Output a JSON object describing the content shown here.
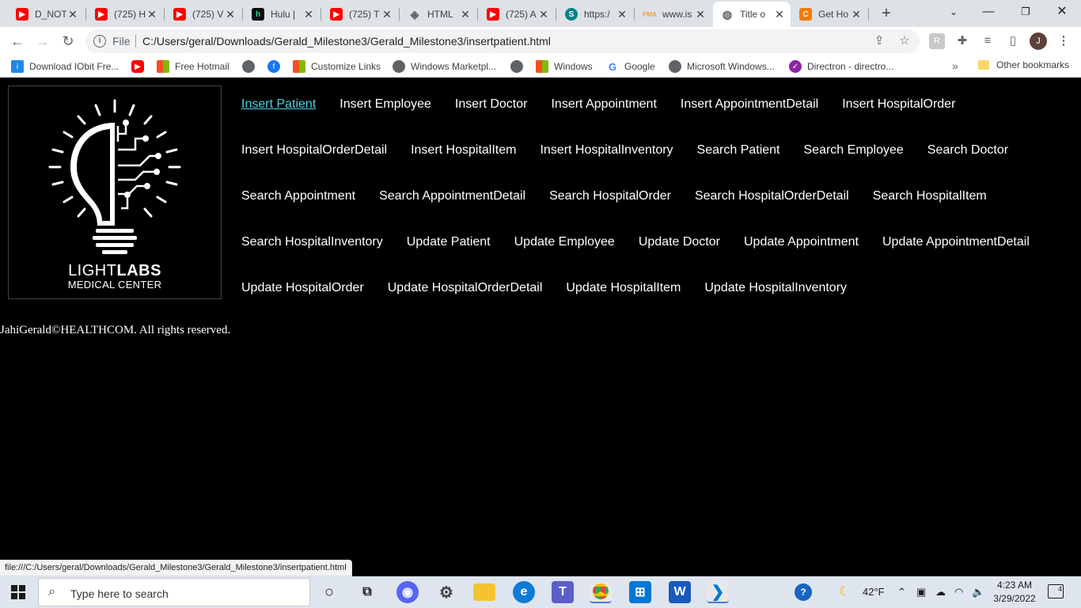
{
  "browser": {
    "tabs": [
      {
        "title": "D_NOT",
        "favicon": "youtube-icon",
        "color": "#ff0000"
      },
      {
        "title": "(725) H",
        "favicon": "youtube-icon",
        "color": "#ff0000"
      },
      {
        "title": "(725) V",
        "favicon": "youtube-icon",
        "color": "#ff0000"
      },
      {
        "title": "Hulu |",
        "favicon": "hulu-icon",
        "color": "#1ce783"
      },
      {
        "title": "(725) T",
        "favicon": "youtube-icon",
        "color": "#ff0000"
      },
      {
        "title": "HTML",
        "favicon": "diamond-icon",
        "color": "#5f6368"
      },
      {
        "title": "(725) A",
        "favicon": "youtube-icon",
        "color": "#ff0000"
      },
      {
        "title": "https:/",
        "favicon": "sharepoint-icon",
        "color": "#038387"
      },
      {
        "title": "www.is",
        "favicon": "pma-icon",
        "color": "#e8a33d"
      },
      {
        "title": "Title o",
        "favicon": "globe-icon",
        "color": "#5f6368"
      },
      {
        "title": "Get Ho",
        "favicon": "c-icon",
        "color": "#f57c00"
      }
    ],
    "new_tab": "+",
    "address": {
      "scheme_label": "File",
      "url": "C:/Users/geral/Downloads/Gerald_Milestone3/Gerald_Milestone3/insertpatient.html"
    },
    "profile_initial": "J",
    "bookmarks": [
      {
        "label": "Download IObit Fre...",
        "icon": "iobit-icon",
        "color": "#1e88e5"
      },
      {
        "label": "",
        "icon": "youtube-icon",
        "color": "#ff0000"
      },
      {
        "label": "Free Hotmail",
        "icon": "microsoft-icon",
        "color": "#f25022"
      },
      {
        "label": "",
        "icon": "globe-icon",
        "color": "#5f6368"
      },
      {
        "label": "",
        "icon": "facebook-icon",
        "color": "#1877f2"
      },
      {
        "label": "Customize Links",
        "icon": "microsoft-icon",
        "color": "#f25022"
      },
      {
        "label": "Windows Marketpl...",
        "icon": "globe-icon",
        "color": "#5f6368"
      },
      {
        "label": "",
        "icon": "globe-icon",
        "color": "#5f6368"
      },
      {
        "label": "Windows",
        "icon": "microsoft-icon",
        "color": "#f25022"
      },
      {
        "label": "Google",
        "icon": "google-icon",
        "color": "#4285f4"
      },
      {
        "label": "Microsoft Windows...",
        "icon": "globe-icon",
        "color": "#5f6368"
      },
      {
        "label": "Directron - directro...",
        "icon": "directron-icon",
        "color": "#8e24aa"
      }
    ],
    "bookmarks_more": "»",
    "other_bookmarks": "Other bookmarks",
    "status_url": "file:///C:/Users/geral/Downloads/Gerald_Milestone3/Gerald_Milestone3/insertpatient.html"
  },
  "page": {
    "logo": {
      "word_thin": "LIGHT",
      "word_bold": "LABS",
      "subtitle": "MEDICAL CENTER"
    },
    "nav_links": [
      "Insert Patient",
      "Insert Employee",
      "Insert Doctor",
      "Insert Appointment",
      "Insert AppointmentDetail",
      "Insert HospitalOrder",
      "Insert HospitalOrderDetail",
      "Insert HospitalItem",
      "Insert HospitalInventory",
      "Search Patient",
      "Search Employee",
      "Search Doctor",
      "Search Appointment",
      "Search AppointmentDetail",
      "Search HospitalOrder",
      "Search HospitalOrderDetail",
      "Search HospitalItem",
      "Search HospitalInventory",
      "Update Patient",
      "Update Employee",
      "Update Doctor",
      "Update Appointment",
      "Update AppointmentDetail",
      "Update HospitalOrder",
      "Update HospitalOrderDetail",
      "Update HospitalItem",
      "Update HospitalInventory"
    ],
    "active_link": "Insert Patient",
    "footer": "JahiGerald©HEALTHCOM. All rights reserved.",
    "colors": {
      "background": "#000000",
      "link": "#ffffff",
      "active_link": "#4dd0e1"
    }
  },
  "taskbar": {
    "search_placeholder": "Type here to search",
    "weather": "42°F",
    "time": "4:23 AM",
    "date": "3/29/2022",
    "notifications": "4"
  }
}
